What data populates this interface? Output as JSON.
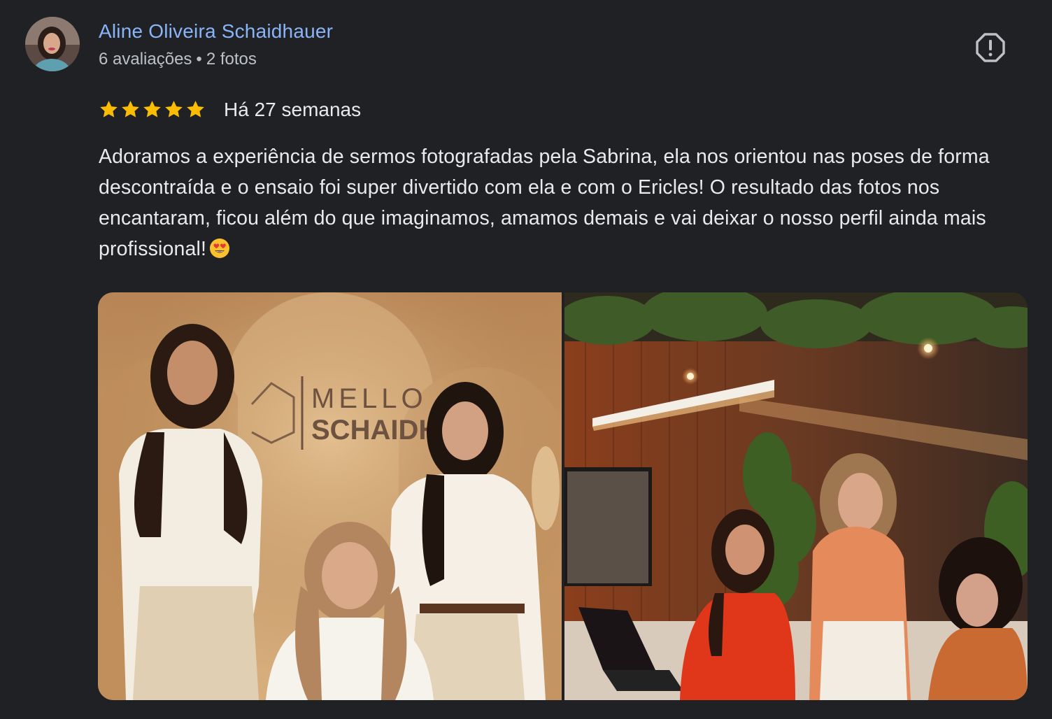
{
  "author": {
    "name": "Aline Oliveira Schaidhauer",
    "reviews_count": "6 avaliações",
    "separator": "•",
    "photos_count": "2 fotos",
    "avatar_icon": "avatar"
  },
  "report": {
    "icon": "report-octagon-icon"
  },
  "rating": {
    "stars": 5,
    "max": 5,
    "color": "#fbbc04"
  },
  "timestamp": "Há 27 semanas",
  "review_text": "Adoramos a experiência de sermos fotografadas pela Sabrina, ela nos orientou nas poses de forma descontraída e o ensaio foi super divertido com ela e com o Ericles! O resultado das fotos nos encantaram, ficou além do que imaginamos, amamos demais e vai deixar o nosso perfil ainda mais profissional!",
  "review_emoji": "heart-eyes-emoji",
  "photos": [
    {
      "name": "photo-1",
      "sign_line1": "MELLO",
      "sign_line2": "SCHAIDH"
    },
    {
      "name": "photo-2"
    }
  ],
  "colors": {
    "background": "#202124",
    "author_link": "#8ab4f8",
    "meta_text": "#bdc1c6",
    "body_text": "#e8eaed"
  }
}
